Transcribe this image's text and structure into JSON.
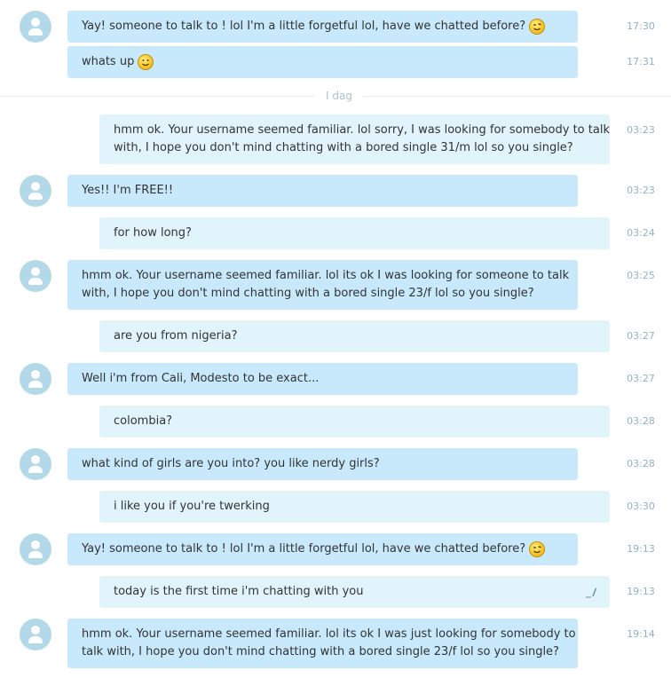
{
  "day_divider": "I dag",
  "messages": [
    {
      "dir": "in",
      "lines": [
        "Yay! someone to talk to ! lol   I'm a little forgetful lol, have we chatted before?"
      ],
      "emoji": "wink",
      "time": "17:30"
    },
    {
      "dir": "in",
      "lines": [
        "whats up"
      ],
      "emoji": "smile",
      "time": "17:31"
    },
    {
      "dir": "out",
      "lines": [
        "hmm ok. Your username seemed familiar. lol sorry, I was looking for somebody to talk",
        "with, I hope you don't mind chatting with a bored single 31/m lol  so you single?"
      ],
      "time": "03:23"
    },
    {
      "dir": "in",
      "lines": [
        "Yes!! I'm FREE!!"
      ],
      "time": "03:23"
    },
    {
      "dir": "out",
      "lines": [
        "for how long?"
      ],
      "time": "03:24"
    },
    {
      "dir": "in",
      "lines": [
        "hmm ok. Your username seemed familiar. lol its ok I was looking for someone to talk",
        "with, I hope you don't mind chatting with a bored single 23/f lol  so you single?"
      ],
      "time": "03:25"
    },
    {
      "dir": "out",
      "lines": [
        "are you from nigeria?"
      ],
      "time": "03:27"
    },
    {
      "dir": "in",
      "lines": [
        "Well i'm from Cali, Modesto to be exact..."
      ],
      "time": "03:27"
    },
    {
      "dir": "out",
      "lines": [
        "colombia?"
      ],
      "time": "03:28"
    },
    {
      "dir": "in",
      "lines": [
        "what kind of girls are you into? you like nerdy girls?"
      ],
      "time": "03:28"
    },
    {
      "dir": "out",
      "lines": [
        "i like you if you're twerking"
      ],
      "time": "03:30"
    },
    {
      "dir": "in",
      "lines": [
        "Yay! someone to talk to ! lol   I'm a little forgetful lol, have we chatted before?"
      ],
      "emoji": "wink",
      "time": "19:13"
    },
    {
      "dir": "out",
      "lines": [
        "today is the first time i'm chatting with you"
      ],
      "edit_icon": "edit-pencil-icon",
      "time": "19:13"
    },
    {
      "dir": "in",
      "lines": [
        "hmm ok. Your username seemed familiar. lol its ok I was just looking for somebody to",
        "talk with, I hope you don't mind chatting with a bored single 23/f lol  so you single?"
      ],
      "time": "19:14"
    }
  ],
  "colors": {
    "incoming_bubble": "#c7e9fb",
    "outgoing_bubble": "#e1f4fc",
    "avatar": "#b3d9e8",
    "timestamp": "#8fb3c5"
  }
}
